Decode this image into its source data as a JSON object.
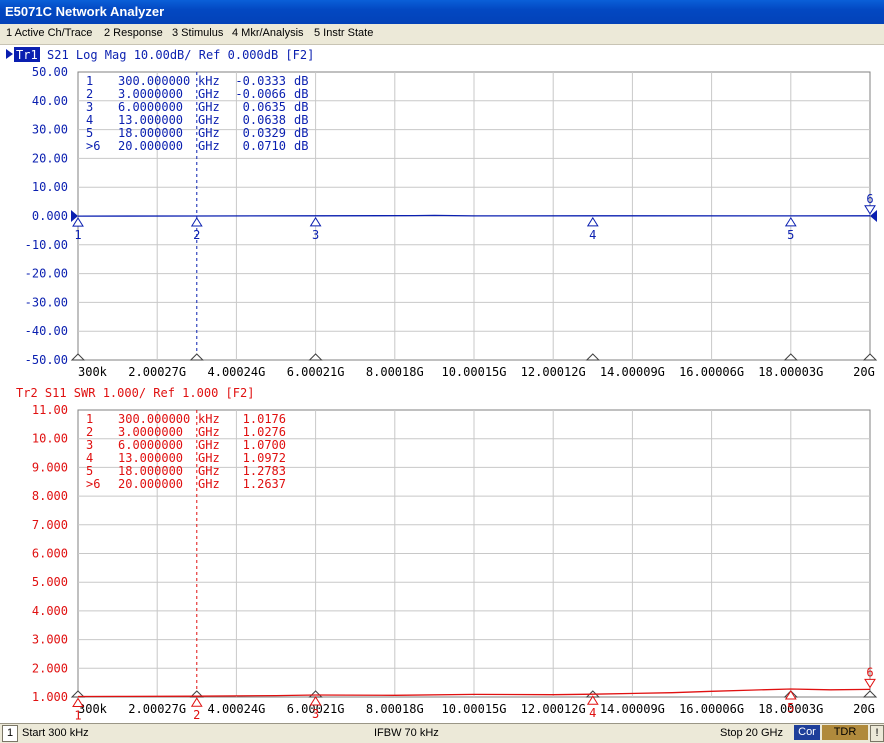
{
  "window": {
    "title": "E5071C Network Analyzer"
  },
  "menu": [
    {
      "label": "1 Active Ch/Trace"
    },
    {
      "label": "2 Response"
    },
    {
      "label": "3 Stimulus"
    },
    {
      "label": "4 Mkr/Analysis"
    },
    {
      "label": "5 Instr State"
    }
  ],
  "colors": {
    "trace1": "#0a1fb0",
    "trace2": "#e01010",
    "grid": "#c8c8c8"
  },
  "trace1": {
    "tag": "Tr1",
    "header": "S21 Log Mag 10.00dB/ Ref 0.000dB [F2]",
    "y_ticks": [
      "50.00",
      "40.00",
      "30.00",
      "20.00",
      "10.00",
      "0.000",
      "-10.00",
      "-20.00",
      "-30.00",
      "-40.00",
      "-50.00"
    ],
    "markers": [
      {
        "num": "1",
        "freq": "300.000000",
        "unit": "kHz",
        "value": "-0.0333",
        "vunit": "dB"
      },
      {
        "num": "2",
        "freq": "3.0000000",
        "unit": "GHz",
        "value": "-0.0066",
        "vunit": "dB"
      },
      {
        "num": "3",
        "freq": "6.0000000",
        "unit": "GHz",
        "value": "0.0635",
        "vunit": "dB"
      },
      {
        "num": "4",
        "freq": "13.000000",
        "unit": "GHz",
        "value": "0.0638",
        "vunit": "dB"
      },
      {
        "num": "5",
        "freq": "18.000000",
        "unit": "GHz",
        "value": "0.0329",
        "vunit": "dB"
      },
      {
        "num": ">6",
        "freq": "20.000000",
        "unit": "GHz",
        "value": "0.0710",
        "vunit": "dB"
      }
    ]
  },
  "trace2": {
    "header": "Tr2 S11 SWR 1.000/ Ref 1.000 [F2]",
    "y_ticks": [
      "11.00",
      "10.00",
      "9.000",
      "8.000",
      "7.000",
      "6.000",
      "5.000",
      "4.000",
      "3.000",
      "2.000",
      "1.000"
    ],
    "markers": [
      {
        "num": "1",
        "freq": "300.000000",
        "unit": "kHz",
        "value": "1.0176"
      },
      {
        "num": "2",
        "freq": "3.0000000",
        "unit": "GHz",
        "value": "1.0276"
      },
      {
        "num": "3",
        "freq": "6.0000000",
        "unit": "GHz",
        "value": "1.0700"
      },
      {
        "num": "4",
        "freq": "13.000000",
        "unit": "GHz",
        "value": "1.0972"
      },
      {
        "num": "5",
        "freq": "18.000000",
        "unit": "GHz",
        "value": "1.2783"
      },
      {
        "num": ">6",
        "freq": "20.000000",
        "unit": "GHz",
        "value": "1.2637"
      }
    ]
  },
  "x_ticks": [
    "300k",
    "2.00027G",
    "4.00024G",
    "6.00021G",
    "8.00018G",
    "10.00015G",
    "12.00012G",
    "14.00009G",
    "16.00006G",
    "18.00003G",
    "20G"
  ],
  "marker_labels": [
    "1",
    "2",
    "3",
    "4",
    "5",
    "6"
  ],
  "status": {
    "channel": "1",
    "start": "Start 300 kHz",
    "ifbw": "IFBW 70 kHz",
    "stop": "Stop 20 GHz",
    "cor": "Cor",
    "tdr": "TDR",
    "alert": "!"
  },
  "chart_data": [
    {
      "type": "line",
      "title": "S21 Log Mag 10.00dB/ Ref 0.000dB [F2]",
      "xlabel": "",
      "ylabel": "",
      "x_unit": "Hz",
      "xlim": [
        300000,
        20000000000
      ],
      "ylim": [
        -50,
        50
      ],
      "grid": true,
      "series": [
        {
          "name": "Tr1",
          "x": [
            300000,
            3000000000,
            6000000000,
            8500000000,
            9000000000,
            10000000000,
            13000000000,
            18000000000,
            20000000000
          ],
          "y": [
            -0.0333,
            -0.0066,
            0.0635,
            0.15,
            0.2,
            0.05,
            0.0638,
            0.0329,
            0.071
          ]
        }
      ],
      "markers": [
        {
          "label": "1",
          "x": 300000,
          "y": -0.0333
        },
        {
          "label": "2",
          "x": 3000000000,
          "y": -0.0066
        },
        {
          "label": "3",
          "x": 6000000000,
          "y": 0.0635
        },
        {
          "label": "4",
          "x": 13000000000,
          "y": 0.0638
        },
        {
          "label": "5",
          "x": 18000000000,
          "y": 0.0329
        },
        {
          "label": "6",
          "x": 20000000000,
          "y": 0.071
        }
      ]
    },
    {
      "type": "line",
      "title": "Tr2 S11 SWR 1.000/ Ref 1.000 [F2]",
      "xlabel": "",
      "ylabel": "",
      "x_unit": "Hz",
      "xlim": [
        300000,
        20000000000
      ],
      "ylim": [
        1,
        11
      ],
      "grid": true,
      "series": [
        {
          "name": "Tr2",
          "x": [
            300000,
            1000000000,
            3000000000,
            5000000000,
            6000000000,
            8000000000,
            10000000000,
            12000000000,
            13000000000,
            15000000000,
            16000000000,
            17000000000,
            18000000000,
            19000000000,
            20000000000
          ],
          "y": [
            1.0176,
            1.02,
            1.0276,
            1.05,
            1.07,
            1.06,
            1.09,
            1.08,
            1.0972,
            1.15,
            1.2,
            1.24,
            1.2783,
            1.25,
            1.2637
          ]
        }
      ],
      "markers": [
        {
          "label": "1",
          "x": 300000,
          "y": 1.0176
        },
        {
          "label": "2",
          "x": 3000000000,
          "y": 1.0276
        },
        {
          "label": "3",
          "x": 6000000000,
          "y": 1.07
        },
        {
          "label": "4",
          "x": 13000000000,
          "y": 1.0972
        },
        {
          "label": "5",
          "x": 18000000000,
          "y": 1.2783
        },
        {
          "label": "6",
          "x": 20000000000,
          "y": 1.2637
        }
      ]
    }
  ]
}
